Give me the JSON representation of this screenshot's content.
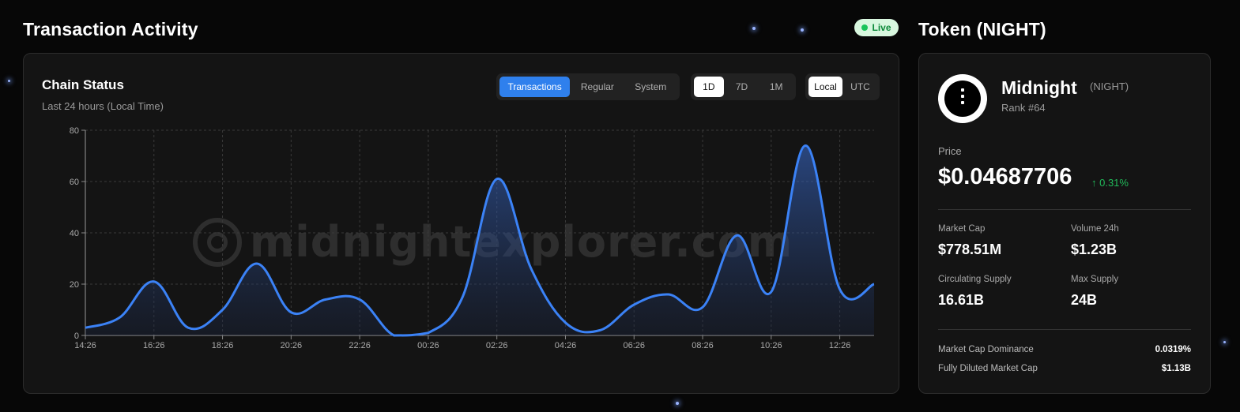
{
  "activity": {
    "title": "Transaction Activity",
    "live_label": "Live",
    "chain_title": "Chain Status",
    "chain_subtitle": "Last 24 hours (Local Time)",
    "type_tabs": [
      "Transactions",
      "Regular",
      "System"
    ],
    "range_tabs": [
      "1D",
      "7D",
      "1M"
    ],
    "tz_tabs": [
      "Local",
      "UTC"
    ],
    "watermark": "midnightexplorer.com"
  },
  "chart_data": {
    "type": "area",
    "series": [
      {
        "x": [
          "14:26",
          "15:26",
          "16:26",
          "17:26",
          "18:26",
          "19:26",
          "20:26",
          "21:26",
          "22:26",
          "23:26",
          "00:26",
          "01:26",
          "02:26",
          "03:26",
          "04:26",
          "05:26",
          "06:26",
          "07:26",
          "08:26",
          "09:26",
          "10:26",
          "11:26",
          "12:26",
          "13:26"
        ],
        "y": [
          3,
          7,
          21,
          3,
          10,
          28,
          9,
          14,
          14,
          0,
          1,
          15,
          61,
          26,
          5,
          2,
          12,
          16,
          11,
          39,
          17,
          74,
          18,
          20
        ]
      }
    ],
    "xticks": [
      "14:26",
      "16:26",
      "18:26",
      "20:26",
      "22:26",
      "00:26",
      "02:26",
      "04:26",
      "06:26",
      "08:26",
      "10:26",
      "12:26"
    ],
    "yticks": [
      0,
      20,
      40,
      60,
      80
    ],
    "ylim": [
      0,
      80
    ],
    "grid": true,
    "line_color": "#3b82f6"
  },
  "token": {
    "section_title": "Token (NIGHT)",
    "name": "Midnight",
    "symbol": "(NIGHT)",
    "rank": "Rank #64",
    "price_label": "Price",
    "price": "$0.04687706",
    "change": "↑ 0.31%",
    "market_cap_label": "Market Cap",
    "market_cap": "$778.51M",
    "volume_label": "Volume 24h",
    "volume": "$1.23B",
    "circ_label": "Circulating Supply",
    "circ": "16.61B",
    "max_label": "Max Supply",
    "max": "24B",
    "dominance_label": "Market Cap Dominance",
    "dominance": "0.0319%",
    "fdmc_label": "Fully Diluted Market Cap",
    "fdmc": "$1.13B"
  }
}
